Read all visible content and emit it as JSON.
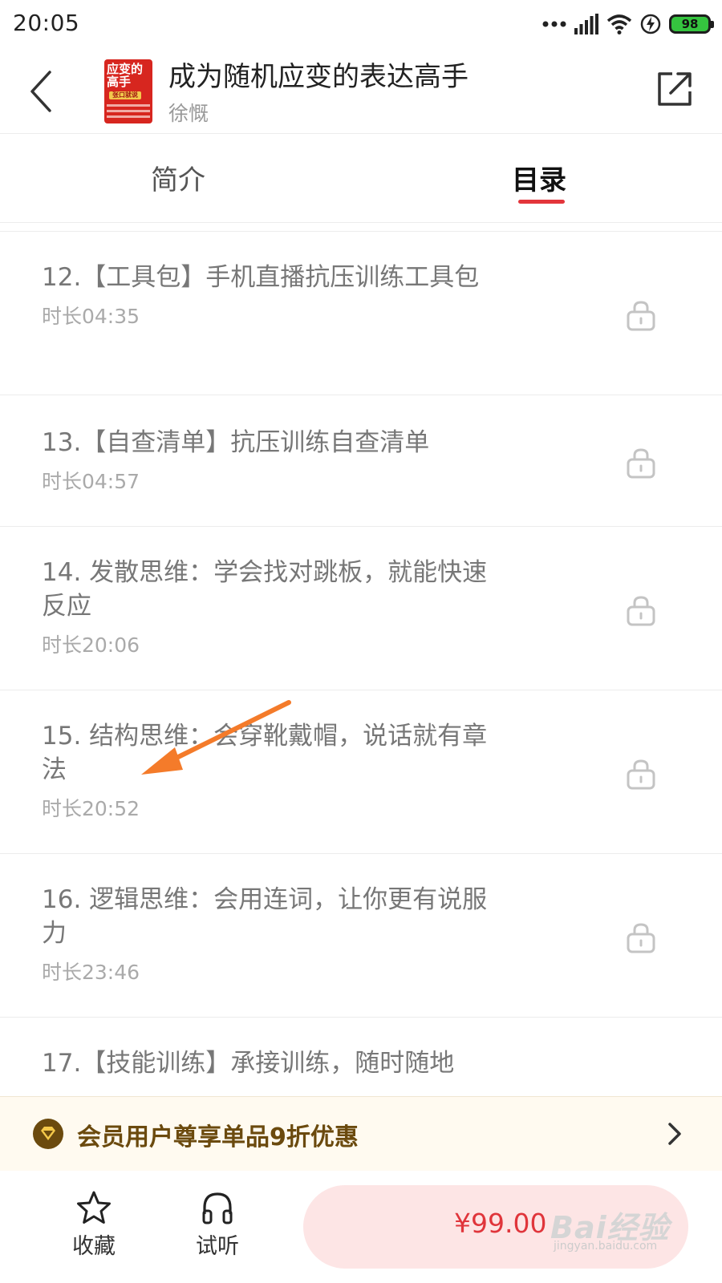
{
  "status_bar": {
    "time": "20:05",
    "battery_level": "98",
    "icons": [
      "more-dots-icon",
      "signal-icon",
      "wifi-icon",
      "charging-icon",
      "battery-icon"
    ]
  },
  "header": {
    "book_title": "成为随机应变的表达高手",
    "author": "徐慨",
    "cover": {
      "line1": "应变的",
      "line2": "高手",
      "tag": "张口就说"
    }
  },
  "tabs": {
    "intro": "简介",
    "catalog": "目录",
    "active": "catalog"
  },
  "lessons": [
    {
      "title": "12.【工具包】手机直播抗压训练工具包",
      "duration": "时长04:35",
      "locked": true
    },
    {
      "title": "13.【自查清单】抗压训练自查清单",
      "duration": "时长04:57",
      "locked": true
    },
    {
      "title": "14. 发散思维：学会找对跳板，就能快速反应",
      "duration": "时长20:06",
      "locked": true
    },
    {
      "title": "15. 结构思维：会穿靴戴帽，说话就有章法",
      "duration": "时长20:52",
      "locked": true
    },
    {
      "title": "16. 逻辑思维：会用连词，让你更有说服力",
      "duration": "时长23:46",
      "locked": true
    },
    {
      "title": "17.【技能训练】承接训练，随时随地",
      "duration": "",
      "locked": true
    }
  ],
  "vip_banner": {
    "text": "会员用户尊享单品9折优惠"
  },
  "bottom_bar": {
    "favorite_label": "收藏",
    "listen_label": "试听",
    "price": "¥99.00"
  },
  "watermark": {
    "main": "Bai经验",
    "sub": "jingyan.baidu.com"
  },
  "colors": {
    "accent_red": "#e3353b",
    "buy_bg": "#fde5e5",
    "vip_text": "#6b4a0e",
    "annotation_arrow": "#f47b2a"
  }
}
